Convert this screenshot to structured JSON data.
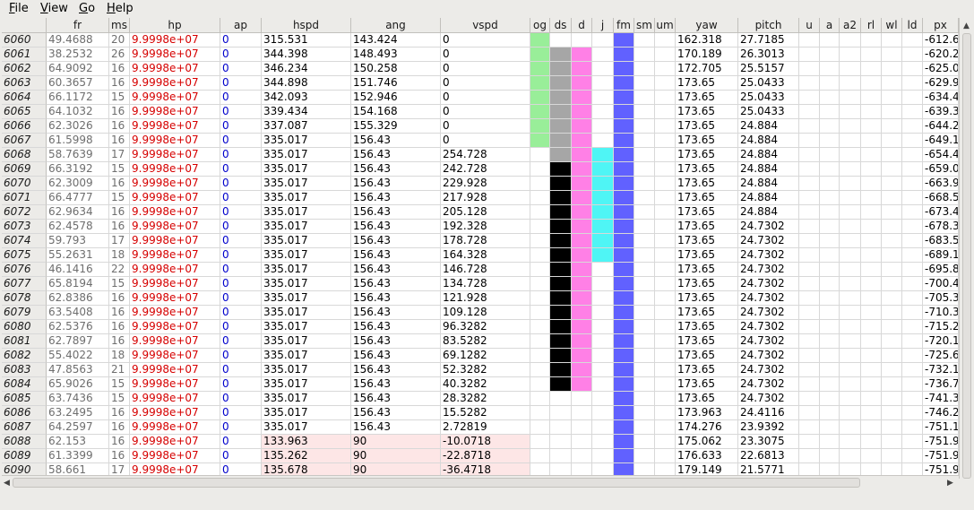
{
  "menu": [
    {
      "label": "File",
      "mn": "F",
      "rest": "ile"
    },
    {
      "label": "View",
      "mn": "V",
      "rest": "iew"
    },
    {
      "label": "Go",
      "mn": "G",
      "rest": "o"
    },
    {
      "label": "Help",
      "mn": "H",
      "rest": "elp"
    }
  ],
  "columns": [
    "",
    "fr",
    "ms",
    "hp",
    "ap",
    "hspd",
    "ang",
    "vspd",
    "og",
    "ds",
    "d",
    "j",
    "fm",
    "sm",
    "um",
    "yaw",
    "pitch",
    "u",
    "a",
    "a2",
    "rl",
    "wl",
    "ld",
    "px"
  ],
  "colors": {
    "og_green": "#99ee99",
    "ds_gray": "#a6a6a6",
    "ds_black": "#000000",
    "d_pink": "#ff80e6",
    "j_cyan": "#4ff5f5",
    "fm_blue": "#6161ff",
    "highlight_row": "#fde6e6",
    "hp_red": "#d60000",
    "ap_blue": "#0000cc"
  },
  "rows": [
    {
      "id": "6060",
      "fr": "49.4688",
      "ms": "20",
      "hp": "9.9998e+07",
      "ap": "0",
      "hspd": "315.531",
      "ang": "143.424",
      "vspd": "0",
      "og": true,
      "ds": "",
      "d": false,
      "j": false,
      "fm": true,
      "yaw": "162.318",
      "pitch": "27.7185",
      "px": "-612.6"
    },
    {
      "id": "6061",
      "fr": "38.2532",
      "ms": "26",
      "hp": "9.9998e+07",
      "ap": "0",
      "hspd": "344.398",
      "ang": "148.493",
      "vspd": "0",
      "og": true,
      "ds": "gray",
      "d": true,
      "j": false,
      "fm": true,
      "yaw": "170.189",
      "pitch": "26.3013",
      "px": "-620.2"
    },
    {
      "id": "6062",
      "fr": "64.9092",
      "ms": "16",
      "hp": "9.9998e+07",
      "ap": "0",
      "hspd": "346.234",
      "ang": "150.258",
      "vspd": "0",
      "og": true,
      "ds": "gray",
      "d": true,
      "j": false,
      "fm": true,
      "yaw": "172.705",
      "pitch": "25.5157",
      "px": "-625.0"
    },
    {
      "id": "6063",
      "fr": "60.3657",
      "ms": "16",
      "hp": "9.9998e+07",
      "ap": "0",
      "hspd": "344.898",
      "ang": "151.746",
      "vspd": "0",
      "og": true,
      "ds": "gray",
      "d": true,
      "j": false,
      "fm": true,
      "yaw": "173.65",
      "pitch": "25.0433",
      "px": "-629.9"
    },
    {
      "id": "6064",
      "fr": "66.1172",
      "ms": "15",
      "hp": "9.9998e+07",
      "ap": "0",
      "hspd": "342.093",
      "ang": "152.946",
      "vspd": "0",
      "og": true,
      "ds": "gray",
      "d": true,
      "j": false,
      "fm": true,
      "yaw": "173.65",
      "pitch": "25.0433",
      "px": "-634.4"
    },
    {
      "id": "6065",
      "fr": "64.1032",
      "ms": "16",
      "hp": "9.9998e+07",
      "ap": "0",
      "hspd": "339.434",
      "ang": "154.168",
      "vspd": "0",
      "og": true,
      "ds": "gray",
      "d": true,
      "j": false,
      "fm": true,
      "yaw": "173.65",
      "pitch": "25.0433",
      "px": "-639.3"
    },
    {
      "id": "6066",
      "fr": "62.3026",
      "ms": "16",
      "hp": "9.9998e+07",
      "ap": "0",
      "hspd": "337.087",
      "ang": "155.329",
      "vspd": "0",
      "og": true,
      "ds": "gray",
      "d": true,
      "j": false,
      "fm": true,
      "yaw": "173.65",
      "pitch": "24.884",
      "px": "-644.2"
    },
    {
      "id": "6067",
      "fr": "61.5998",
      "ms": "16",
      "hp": "9.9998e+07",
      "ap": "0",
      "hspd": "335.017",
      "ang": "156.43",
      "vspd": "0",
      "og": true,
      "ds": "gray",
      "d": true,
      "j": false,
      "fm": true,
      "yaw": "173.65",
      "pitch": "24.884",
      "px": "-649.1"
    },
    {
      "id": "6068",
      "fr": "58.7639",
      "ms": "17",
      "hp": "9.9998e+07",
      "ap": "0",
      "hspd": "335.017",
      "ang": "156.43",
      "vspd": "254.728",
      "og": false,
      "ds": "gray",
      "d": true,
      "j": true,
      "fm": true,
      "yaw": "173.65",
      "pitch": "24.884",
      "px": "-654.4"
    },
    {
      "id": "6069",
      "fr": "66.3192",
      "ms": "15",
      "hp": "9.9998e+07",
      "ap": "0",
      "hspd": "335.017",
      "ang": "156.43",
      "vspd": "242.728",
      "og": false,
      "ds": "black",
      "d": true,
      "j": true,
      "fm": true,
      "yaw": "173.65",
      "pitch": "24.884",
      "px": "-659.0"
    },
    {
      "id": "6070",
      "fr": "62.3009",
      "ms": "16",
      "hp": "9.9998e+07",
      "ap": "0",
      "hspd": "335.017",
      "ang": "156.43",
      "vspd": "229.928",
      "og": false,
      "ds": "black",
      "d": true,
      "j": true,
      "fm": true,
      "yaw": "173.65",
      "pitch": "24.884",
      "px": "-663.9"
    },
    {
      "id": "6071",
      "fr": "66.4777",
      "ms": "15",
      "hp": "9.9998e+07",
      "ap": "0",
      "hspd": "335.017",
      "ang": "156.43",
      "vspd": "217.928",
      "og": false,
      "ds": "black",
      "d": true,
      "j": true,
      "fm": true,
      "yaw": "173.65",
      "pitch": "24.884",
      "px": "-668.5"
    },
    {
      "id": "6072",
      "fr": "62.9634",
      "ms": "16",
      "hp": "9.9998e+07",
      "ap": "0",
      "hspd": "335.017",
      "ang": "156.43",
      "vspd": "205.128",
      "og": false,
      "ds": "black",
      "d": true,
      "j": true,
      "fm": true,
      "yaw": "173.65",
      "pitch": "24.884",
      "px": "-673.4"
    },
    {
      "id": "6073",
      "fr": "62.4578",
      "ms": "16",
      "hp": "9.9998e+07",
      "ap": "0",
      "hspd": "335.017",
      "ang": "156.43",
      "vspd": "192.328",
      "og": false,
      "ds": "black",
      "d": true,
      "j": true,
      "fm": true,
      "yaw": "173.65",
      "pitch": "24.7302",
      "px": "-678.3"
    },
    {
      "id": "6074",
      "fr": "59.793",
      "ms": "17",
      "hp": "9.9998e+07",
      "ap": "0",
      "hspd": "335.017",
      "ang": "156.43",
      "vspd": "178.728",
      "og": false,
      "ds": "black",
      "d": true,
      "j": true,
      "fm": true,
      "yaw": "173.65",
      "pitch": "24.7302",
      "px": "-683.5"
    },
    {
      "id": "6075",
      "fr": "55.2631",
      "ms": "18",
      "hp": "9.9998e+07",
      "ap": "0",
      "hspd": "335.017",
      "ang": "156.43",
      "vspd": "164.328",
      "og": false,
      "ds": "black",
      "d": true,
      "j": true,
      "fm": true,
      "yaw": "173.65",
      "pitch": "24.7302",
      "px": "-689.1"
    },
    {
      "id": "6076",
      "fr": "46.1416",
      "ms": "22",
      "hp": "9.9998e+07",
      "ap": "0",
      "hspd": "335.017",
      "ang": "156.43",
      "vspd": "146.728",
      "og": false,
      "ds": "black",
      "d": true,
      "j": false,
      "fm": true,
      "yaw": "173.65",
      "pitch": "24.7302",
      "px": "-695.8"
    },
    {
      "id": "6077",
      "fr": "65.8194",
      "ms": "15",
      "hp": "9.9998e+07",
      "ap": "0",
      "hspd": "335.017",
      "ang": "156.43",
      "vspd": "134.728",
      "og": false,
      "ds": "black",
      "d": true,
      "j": false,
      "fm": true,
      "yaw": "173.65",
      "pitch": "24.7302",
      "px": "-700.4"
    },
    {
      "id": "6078",
      "fr": "62.8386",
      "ms": "16",
      "hp": "9.9998e+07",
      "ap": "0",
      "hspd": "335.017",
      "ang": "156.43",
      "vspd": "121.928",
      "og": false,
      "ds": "black",
      "d": true,
      "j": false,
      "fm": true,
      "yaw": "173.65",
      "pitch": "24.7302",
      "px": "-705.3"
    },
    {
      "id": "6079",
      "fr": "63.5408",
      "ms": "16",
      "hp": "9.9998e+07",
      "ap": "0",
      "hspd": "335.017",
      "ang": "156.43",
      "vspd": "109.128",
      "og": false,
      "ds": "black",
      "d": true,
      "j": false,
      "fm": true,
      "yaw": "173.65",
      "pitch": "24.7302",
      "px": "-710.3"
    },
    {
      "id": "6080",
      "fr": "62.5376",
      "ms": "16",
      "hp": "9.9998e+07",
      "ap": "0",
      "hspd": "335.017",
      "ang": "156.43",
      "vspd": "96.3282",
      "og": false,
      "ds": "black",
      "d": true,
      "j": false,
      "fm": true,
      "yaw": "173.65",
      "pitch": "24.7302",
      "px": "-715.2"
    },
    {
      "id": "6081",
      "fr": "62.7897",
      "ms": "16",
      "hp": "9.9998e+07",
      "ap": "0",
      "hspd": "335.017",
      "ang": "156.43",
      "vspd": "83.5282",
      "og": false,
      "ds": "black",
      "d": true,
      "j": false,
      "fm": true,
      "yaw": "173.65",
      "pitch": "24.7302",
      "px": "-720.1"
    },
    {
      "id": "6082",
      "fr": "55.4022",
      "ms": "18",
      "hp": "9.9998e+07",
      "ap": "0",
      "hspd": "335.017",
      "ang": "156.43",
      "vspd": "69.1282",
      "og": false,
      "ds": "black",
      "d": true,
      "j": false,
      "fm": true,
      "yaw": "173.65",
      "pitch": "24.7302",
      "px": "-725.6"
    },
    {
      "id": "6083",
      "fr": "47.8563",
      "ms": "21",
      "hp": "9.9998e+07",
      "ap": "0",
      "hspd": "335.017",
      "ang": "156.43",
      "vspd": "52.3282",
      "og": false,
      "ds": "black",
      "d": true,
      "j": false,
      "fm": true,
      "yaw": "173.65",
      "pitch": "24.7302",
      "px": "-732.1"
    },
    {
      "id": "6084",
      "fr": "65.9026",
      "ms": "15",
      "hp": "9.9998e+07",
      "ap": "0",
      "hspd": "335.017",
      "ang": "156.43",
      "vspd": "40.3282",
      "og": false,
      "ds": "black",
      "d": true,
      "j": false,
      "fm": true,
      "yaw": "173.65",
      "pitch": "24.7302",
      "px": "-736.7"
    },
    {
      "id": "6085",
      "fr": "63.7436",
      "ms": "15",
      "hp": "9.9998e+07",
      "ap": "0",
      "hspd": "335.017",
      "ang": "156.43",
      "vspd": "28.3282",
      "og": false,
      "ds": "",
      "d": false,
      "j": false,
      "fm": true,
      "yaw": "173.65",
      "pitch": "24.7302",
      "px": "-741.3"
    },
    {
      "id": "6086",
      "fr": "63.2495",
      "ms": "16",
      "hp": "9.9998e+07",
      "ap": "0",
      "hspd": "335.017",
      "ang": "156.43",
      "vspd": "15.5282",
      "og": false,
      "ds": "",
      "d": false,
      "j": false,
      "fm": true,
      "yaw": "173.963",
      "pitch": "24.4116",
      "px": "-746.2"
    },
    {
      "id": "6087",
      "fr": "64.2597",
      "ms": "16",
      "hp": "9.9998e+07",
      "ap": "0",
      "hspd": "335.017",
      "ang": "156.43",
      "vspd": "2.72819",
      "og": false,
      "ds": "",
      "d": false,
      "j": false,
      "fm": true,
      "yaw": "174.276",
      "pitch": "23.9392",
      "px": "-751.1"
    },
    {
      "id": "6088",
      "fr": "62.153",
      "ms": "16",
      "hp": "9.9998e+07",
      "ap": "0",
      "hspd": "133.963",
      "ang": "90",
      "vspd": "-10.0718",
      "og": false,
      "ds": "",
      "d": false,
      "j": false,
      "fm": true,
      "yaw": "175.062",
      "pitch": "23.3075",
      "px": "-751.9",
      "hl": true
    },
    {
      "id": "6089",
      "fr": "61.3399",
      "ms": "16",
      "hp": "9.9998e+07",
      "ap": "0",
      "hspd": "135.262",
      "ang": "90",
      "vspd": "-22.8718",
      "og": false,
      "ds": "",
      "d": false,
      "j": false,
      "fm": true,
      "yaw": "176.633",
      "pitch": "22.6813",
      "px": "-751.9",
      "hl": true
    },
    {
      "id": "6090",
      "fr": "58.661",
      "ms": "17",
      "hp": "9.9998e+07",
      "ap": "0",
      "hspd": "135.678",
      "ang": "90",
      "vspd": "-36.4718",
      "og": false,
      "ds": "",
      "d": false,
      "j": false,
      "fm": true,
      "yaw": "179.149",
      "pitch": "21.5771",
      "px": "-751.9",
      "hl": true
    }
  ]
}
